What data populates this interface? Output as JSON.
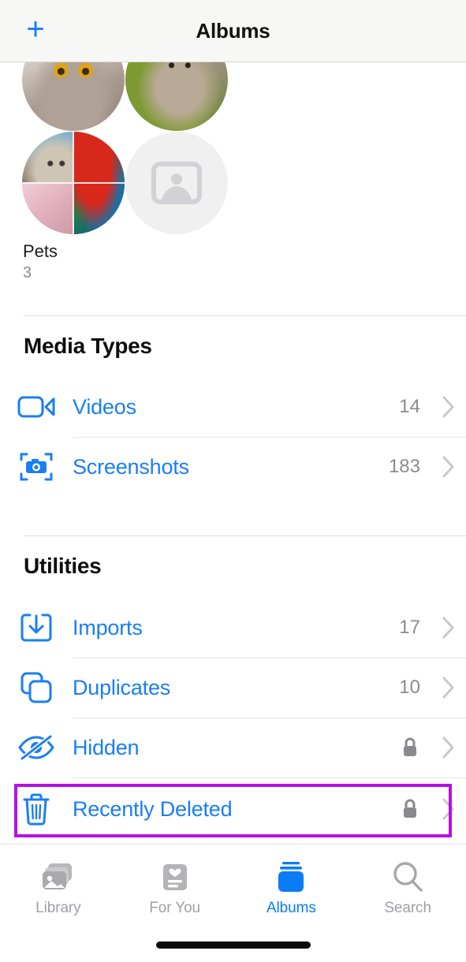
{
  "navbar": {
    "add_label": "+",
    "title": "Albums"
  },
  "people_section": {
    "album_name": "Pets",
    "album_count": "3",
    "placeholder_icon": "person-photo-placeholder-icon"
  },
  "sections": [
    {
      "title": "Media Types",
      "rows": [
        {
          "icon": "video-camera-icon",
          "label": "Videos",
          "count": "14",
          "locked": false,
          "chevron": "›"
        },
        {
          "icon": "screenshot-camera-icon",
          "label": "Screenshots",
          "count": "183",
          "locked": false,
          "chevron": "›"
        }
      ]
    },
    {
      "title": "Utilities",
      "rows": [
        {
          "icon": "import-tray-icon",
          "label": "Imports",
          "count": "17",
          "locked": false,
          "chevron": "›"
        },
        {
          "icon": "duplicate-squares-icon",
          "label": "Duplicates",
          "count": "10",
          "locked": false,
          "chevron": "›"
        },
        {
          "icon": "eye-slash-icon",
          "label": "Hidden",
          "count": "",
          "locked": true,
          "chevron": "›"
        },
        {
          "icon": "trash-icon",
          "label": "Recently Deleted",
          "count": "",
          "locked": true,
          "chevron": "›"
        }
      ]
    }
  ],
  "highlight": {
    "target": "Recently Deleted",
    "color": "#b510e8"
  },
  "tabbar": {
    "tabs": [
      {
        "label": "Library",
        "icon": "photo-stack-icon",
        "active": false
      },
      {
        "label": "For You",
        "icon": "heart-card-icon",
        "active": false
      },
      {
        "label": "Albums",
        "icon": "albums-stack-icon",
        "active": true
      },
      {
        "label": "Search",
        "icon": "search-icon",
        "active": false
      }
    ]
  },
  "colors": {
    "accent_blue": "#1a7ef5",
    "tab_active_blue": "#0a7cf6",
    "secondary_gray": "#8b8b8f",
    "highlight_purple": "#b510e8"
  }
}
